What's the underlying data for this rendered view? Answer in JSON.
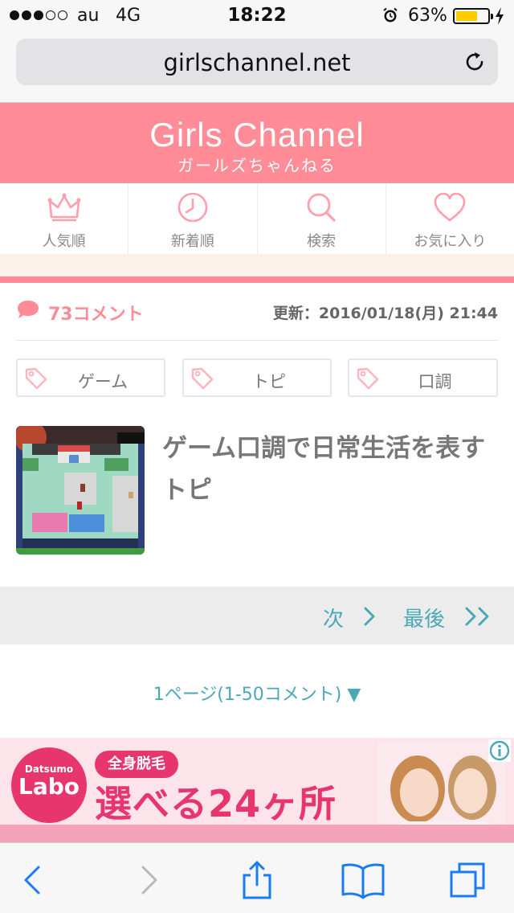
{
  "status_bar": {
    "carrier": "au",
    "network": "4G",
    "time": "18:22",
    "battery_percent": "63%",
    "battery_level": 0.63,
    "signal_bars_filled": 3,
    "signal_bars_total": 5
  },
  "browser": {
    "url": "girlschannel.net"
  },
  "site": {
    "logo_main": "Girls Channel",
    "logo_sub": "ガールズちゃんねる",
    "brand_color": "#ff8c96"
  },
  "nav": {
    "items": [
      {
        "label": "人気順",
        "icon": "crown-icon"
      },
      {
        "label": "新着順",
        "icon": "clock-icon"
      },
      {
        "label": "検索",
        "icon": "search-icon"
      },
      {
        "label": "お気に入り",
        "icon": "heart-icon"
      }
    ]
  },
  "topic": {
    "comment_count": "73コメント",
    "updated": "更新：2016/01/18(月) 21:44",
    "tags": [
      "ゲーム",
      "トピ",
      "口調"
    ],
    "title": "ゲーム口調で日常生活を表すトピ"
  },
  "pager": {
    "next_label": "次",
    "last_label": "最後"
  },
  "page_select": {
    "label": "1ページ(1-50コメント) ▼"
  },
  "ad": {
    "logo_top": "Datsumo",
    "logo_main": "Labo",
    "badge": "全身脱毛",
    "headline": "選べる24ヶ所"
  },
  "colors": {
    "accent_teal": "#4aa8b7",
    "ad_pink": "#e7356e"
  }
}
